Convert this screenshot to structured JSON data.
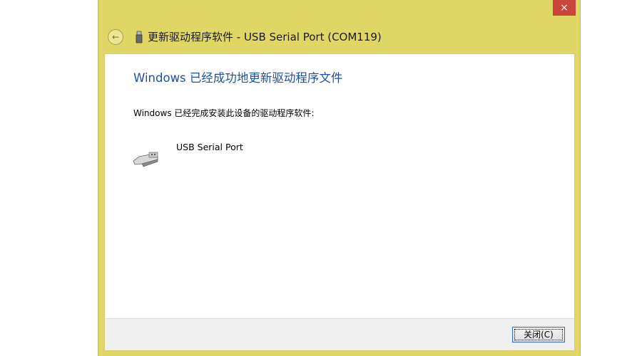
{
  "window": {
    "title": "更新驱动程序软件 - USB Serial Port (COM119)",
    "close_glyph": "×"
  },
  "content": {
    "heading": "Windows 已经成功地更新驱动程序文件",
    "description": "Windows 已经完成安装此设备的驱动程序软件:",
    "device_name": "USB Serial Port"
  },
  "footer": {
    "close_label": "关闭(C)"
  },
  "colors": {
    "frame": "#e0d665",
    "close_button": "#c7453a",
    "heading_text": "#1e50a3"
  },
  "icons": {
    "back": "back-arrow-icon",
    "usb_small": "usb-device-icon",
    "usb_large": "usb-connector-icon"
  }
}
